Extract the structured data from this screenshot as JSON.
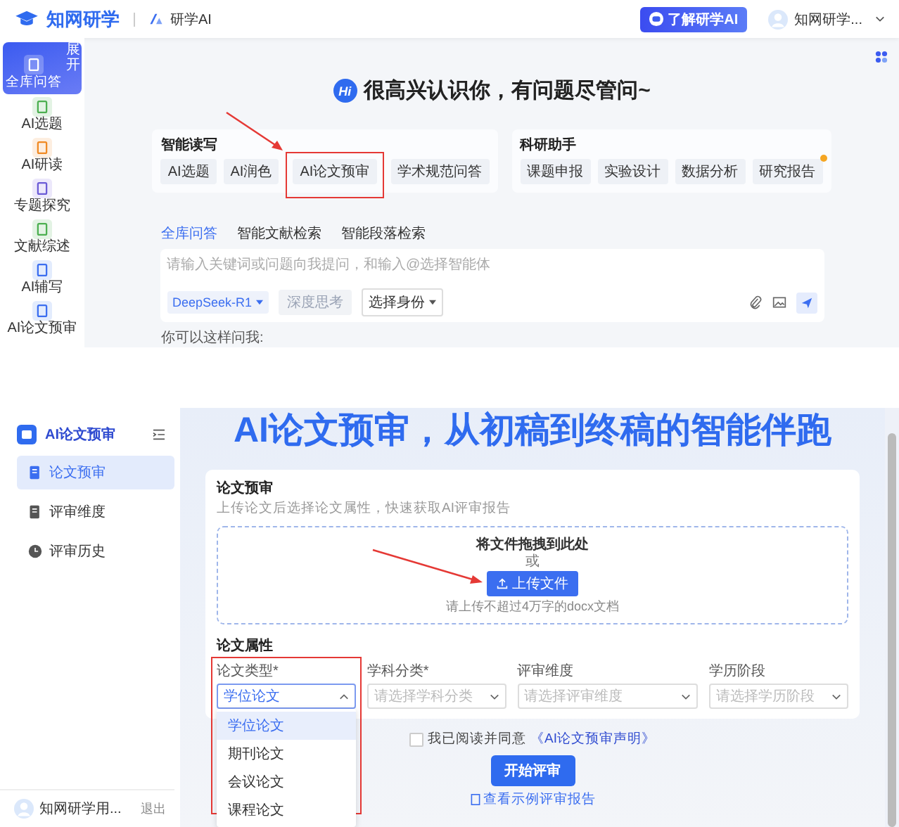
{
  "top_screen": {
    "header": {
      "logo": "知网研学",
      "product": "研学AI",
      "promo_button": "了解研学AI",
      "user_name": "知网研学..."
    },
    "sidebar": [
      {
        "label": "全库问答",
        "selected": true,
        "expand_label": "展开"
      },
      {
        "label": "AI选题",
        "selected": false
      },
      {
        "label": "AI研读",
        "selected": false
      },
      {
        "label": "专题探究",
        "selected": false
      },
      {
        "label": "文献综述",
        "selected": false
      },
      {
        "label": "AI辅写",
        "selected": false
      },
      {
        "label": "AI论文预审",
        "selected": false
      }
    ],
    "greeting_badge": "Hi",
    "greeting": "很高兴认识你，有问题尽管问~",
    "cards": [
      {
        "title": "智能读写",
        "chips": [
          {
            "label": "AI选题",
            "highlighted": false,
            "dot": false
          },
          {
            "label": "AI润色",
            "highlighted": false,
            "dot": false
          },
          {
            "label": "AI论文预审",
            "highlighted": true,
            "dot": false
          },
          {
            "label": "学术规范问答",
            "highlighted": false,
            "dot": false
          }
        ]
      },
      {
        "title": "科研助手",
        "chips": [
          {
            "label": "课题申报",
            "highlighted": false,
            "dot": false
          },
          {
            "label": "实验设计",
            "highlighted": false,
            "dot": false
          },
          {
            "label": "数据分析",
            "highlighted": false,
            "dot": false
          },
          {
            "label": "研究报告",
            "highlighted": false,
            "dot": true
          }
        ]
      }
    ],
    "tabs": [
      {
        "label": "全库问答",
        "selected": true
      },
      {
        "label": "智能文献检索",
        "selected": false
      },
      {
        "label": "智能段落检索",
        "selected": false
      }
    ],
    "input": {
      "placeholder": "请输入关键词或问题向我提问，和输入@选择智能体",
      "model": "DeepSeek-R1",
      "think_button": "深度思考",
      "think_disabled": true,
      "role": "选择身份"
    },
    "hint": "你可以这样问我:"
  },
  "bottom_screen": {
    "sidebar": {
      "title": "AI论文预审",
      "nav": [
        {
          "label": "论文预审",
          "selected": true
        },
        {
          "label": "评审维度",
          "selected": false
        },
        {
          "label": "评审历史",
          "selected": false
        }
      ],
      "user": "知网研学用...",
      "logout": "退出"
    },
    "headline": "AI论文预审，从初稿到终稿的智能伴跑",
    "card": {
      "title": "论文预审",
      "subtitle": "上传论文后选择论文属性，快速获取AI评审报告",
      "dropzone": {
        "prompt": "将文件拖拽到此处",
        "or": "或",
        "upload_button": "上传文件",
        "pointed": true,
        "note": "请上传不超过4万字的docx文档"
      },
      "attributes_title": "论文属性",
      "fields": [
        {
          "label": "论文类型*",
          "value": "学位论文",
          "expanded": true,
          "highlighted": true,
          "options": [
            {
              "label": "学位论文",
              "selected": true
            },
            {
              "label": "期刊论文",
              "selected": false
            },
            {
              "label": "会议论文",
              "selected": false
            },
            {
              "label": "课程论文",
              "selected": false
            }
          ]
        },
        {
          "label": "学科分类*",
          "placeholder": "请选择学科分类",
          "expanded": false,
          "highlighted": false
        },
        {
          "label": "评审维度",
          "placeholder": "请选择评审维度",
          "expanded": false,
          "highlighted": false
        },
        {
          "label": "学历阶段",
          "placeholder": "请选择学历阶段",
          "expanded": false,
          "highlighted": false
        }
      ]
    },
    "agreement": {
      "text": "我已阅读并同意",
      "link": "《AI论文预审声明》",
      "checked": false
    },
    "start_button": "开始评审",
    "sample_link": "查看示例评审报告"
  }
}
